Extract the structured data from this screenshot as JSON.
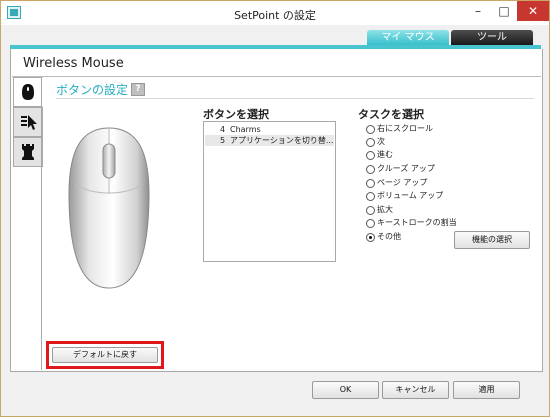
{
  "window": {
    "title": "SetPoint の設定",
    "minimize_glyph": "–",
    "maximize_glyph": "□",
    "close_glyph": "✕"
  },
  "tabs": [
    {
      "label": "マイ マウス",
      "active": true
    },
    {
      "label": "ツール",
      "active": false
    }
  ],
  "device": {
    "name": "Wireless Mouse"
  },
  "side_tabs": [
    {
      "icon": "mouse-icon",
      "active": true
    },
    {
      "icon": "pointer-settings-icon",
      "active": false
    },
    {
      "icon": "chess-rook-icon",
      "active": false
    }
  ],
  "section": {
    "title": "ボタンの設定",
    "help_glyph": "?"
  },
  "button_select": {
    "label": "ボタンを選択",
    "items": [
      {
        "number": "4",
        "text": "Charms",
        "selected": false
      },
      {
        "number": "5",
        "text": "アプリケーションを切り替...",
        "selected": true
      }
    ]
  },
  "task_select": {
    "label": "タスクを選択",
    "options": [
      {
        "label": "右にスクロール",
        "checked": false
      },
      {
        "label": "次",
        "checked": false
      },
      {
        "label": "進む",
        "checked": false
      },
      {
        "label": "クルーズ アップ",
        "checked": false
      },
      {
        "label": "ページ アップ",
        "checked": false
      },
      {
        "label": "ボリューム アップ",
        "checked": false
      },
      {
        "label": "拡大",
        "checked": false
      },
      {
        "label": "キーストロークの割当",
        "checked": false
      },
      {
        "label": "その他",
        "checked": true
      }
    ],
    "function_button": "機能の選択"
  },
  "default_button": "デフォルトに戻す",
  "footer": {
    "ok": "OK",
    "cancel": "キャンセル",
    "apply": "適用"
  },
  "colors": {
    "accent": "#37c0cb",
    "highlight": "#e0171b",
    "close": "#c7372f"
  }
}
